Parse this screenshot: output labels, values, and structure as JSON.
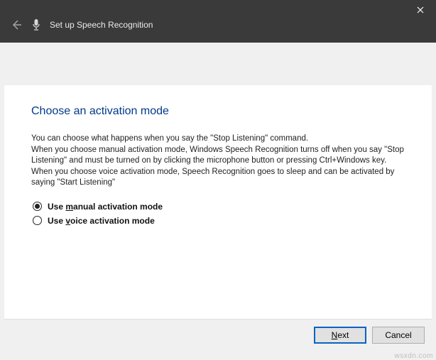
{
  "titlebar": {
    "title": "Set up Speech Recognition"
  },
  "main": {
    "heading": "Choose an activation mode",
    "description": "You can choose what happens when you say the \"Stop Listening\" command.\nWhen you choose manual activation mode, Windows Speech Recognition turns off when you say \"Stop Listening\" and must be turned on by clicking the microphone button or pressing Ctrl+Windows key.\nWhen you choose voice activation mode, Speech Recognition goes to sleep and can be activated by saying \"Start Listening\"",
    "options": {
      "manual_pre": "Use ",
      "manual_m": "m",
      "manual_post": "anual activation mode",
      "voice_pre": "Use ",
      "voice_m": "v",
      "voice_post": "oice activation mode"
    }
  },
  "buttons": {
    "next_m": "N",
    "next_post": "ext",
    "cancel": "Cancel"
  },
  "watermark": "wsxdn.com"
}
